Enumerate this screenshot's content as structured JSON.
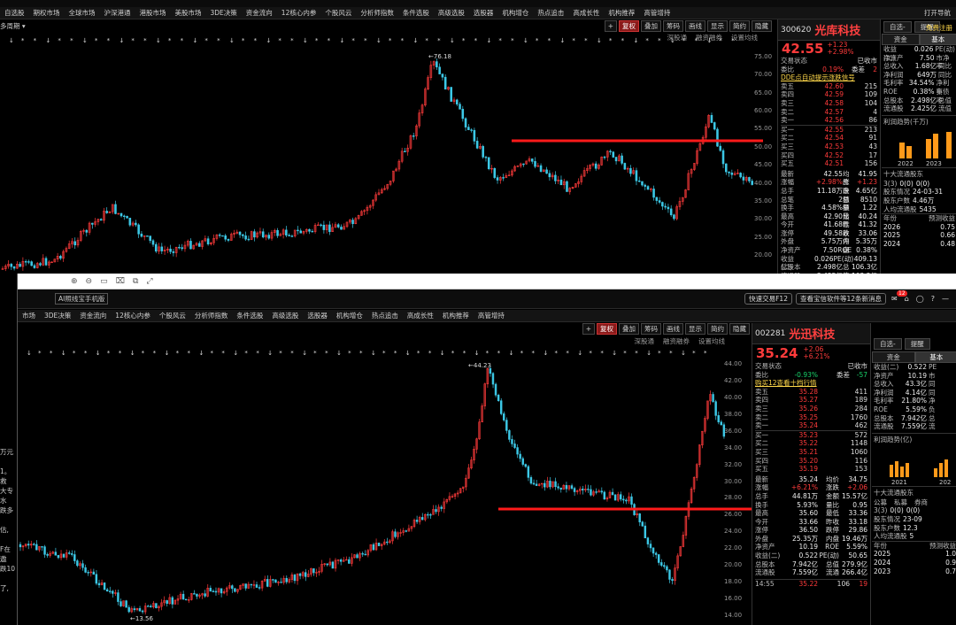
{
  "win1": {
    "menu": [
      "自选股",
      "期权市场",
      "全球市场",
      "沪深港通",
      "港股市场",
      "美股市场",
      "3DE决策",
      "资金流向",
      "12核心内参",
      "个股风云",
      "分析师指数",
      "条件选股",
      "高级选股",
      "选股器",
      "机构增仓",
      "热点追击",
      "高成长性",
      "机构推荐",
      "高管增持"
    ],
    "toolbar": [
      "复权",
      "叠加",
      "筹码",
      "画线",
      "显示",
      "简约",
      "隐藏"
    ],
    "subtabs": [
      "深股通",
      "融资融券",
      "设置均线"
    ],
    "topright": "打开导航",
    "yticks": [
      "75.00",
      "70.00",
      "65.00",
      "60.00",
      "55.00",
      "50.00",
      "45.00",
      "40.00",
      "35.00",
      "30.00",
      "25.00",
      "20.00"
    ],
    "peak_label": "76.18",
    "stock": {
      "code": "300620",
      "name": "光库科技",
      "price": "42.55",
      "change": "+1.23",
      "pct": "+2.98%",
      "status_label": "交易状态",
      "status": "已收市",
      "weibi_label": "委比",
      "weibi": "0.19%",
      "weicha_label": "委差",
      "weicha": "2",
      "link": "DDE点自动提示涨跌信号",
      "asks": [
        [
          "卖五",
          "42.60",
          "215"
        ],
        [
          "卖四",
          "42.59",
          "109"
        ],
        [
          "卖三",
          "42.58",
          "104"
        ],
        [
          "卖二",
          "42.57",
          "4"
        ],
        [
          "卖一",
          "42.56",
          "86"
        ]
      ],
      "bids": [
        [
          "买一",
          "42.55",
          "213"
        ],
        [
          "买二",
          "42.54",
          "91"
        ],
        [
          "买三",
          "42.53",
          "43"
        ],
        [
          "买四",
          "42.52",
          "17"
        ],
        [
          "买五",
          "42.51",
          "156"
        ]
      ],
      "stats": [
        [
          "最新",
          "42.55",
          "均价",
          "41.95"
        ],
        [
          "涨幅",
          "+2.98%",
          "涨跌",
          "+1.23"
        ],
        [
          "总手",
          "11.18万",
          "金额",
          "4.65亿"
        ],
        [
          "总笔",
          "2",
          "总额",
          "8510"
        ],
        [
          "换手",
          "4.58%",
          "量比",
          "1.22"
        ],
        [
          "最高",
          "42.90",
          "最低",
          "40.24"
        ],
        [
          "今开",
          "41.68",
          "昨收",
          "41.32"
        ],
        [
          "涨停",
          "49.58",
          "跌停",
          "33.06"
        ],
        [
          "外盘",
          "5.75万",
          "内盘",
          "5.35万"
        ],
        [
          "净资产",
          "7.50",
          "ROE",
          "0.38%"
        ],
        [
          "收益(二)",
          "0.026",
          "PE(动)",
          "409.13"
        ],
        [
          "总股本",
          "2.498亿",
          "总值",
          "106.3亿"
        ],
        [
          "流通股",
          "2.425亿",
          "流通",
          "103.2亿"
        ]
      ],
      "btn1": "自选-",
      "btn2": "提醒",
      "tabs": [
        "资金",
        "基本"
      ],
      "fund": [
        [
          "收益(二)",
          "0.026",
          "PE(动)"
        ],
        [
          "净资产",
          "7.50",
          "市净率"
        ],
        [
          "总收入",
          "1.68亿",
          "同比"
        ],
        [
          "净利润",
          "649万",
          "同比"
        ],
        [
          "毛利率",
          "34.54%",
          "净利率"
        ],
        [
          "ROE",
          "0.38%",
          "负债率"
        ],
        [
          "总股本",
          "2.498亿",
          "总值"
        ],
        [
          "流通股",
          "2.425亿",
          "流值"
        ]
      ],
      "profit_title": "利润趋势(千万)",
      "years": [
        "2022",
        "2023"
      ],
      "holders_title": "十大流通股东",
      "holders": [
        [
          "3(3)",
          "0(0)",
          "0(0)"
        ],
        [
          "股东情况",
          "24-03-31",
          ""
        ],
        [
          "股东户数",
          "4.46万",
          ""
        ],
        [
          "人均流通股",
          "5435",
          ""
        ]
      ],
      "forecast": [
        [
          "年份",
          "预测收益"
        ],
        [
          "2026",
          "0.75"
        ],
        [
          "2025",
          "0.66"
        ],
        [
          "2024",
          "0.48"
        ]
      ],
      "login": "免费注册"
    }
  },
  "win2": {
    "top_btns": [
      "快速交易F12",
      "查看宝信软件等12条新消息"
    ],
    "badge": "12",
    "title_left": "AI照线宝手机版",
    "menu": [
      "市场",
      "3DE决策",
      "资金流向",
      "12核心内参",
      "个股风云",
      "分析师指数",
      "条件选股",
      "高级选股",
      "选股器",
      "机构增仓",
      "热点追击",
      "高成长性",
      "机构推荐",
      "高管增持"
    ],
    "toolbar": [
      "复权",
      "叠加",
      "筹码",
      "画线",
      "显示",
      "简约",
      "隐藏"
    ],
    "subtabs": [
      "深股通",
      "融资融券",
      "设置均线"
    ],
    "yticks": [
      "44.00",
      "42.00",
      "40.00",
      "38.00",
      "36.00",
      "34.00",
      "32.00",
      "30.00",
      "28.00",
      "26.00",
      "24.00",
      "22.00",
      "20.00",
      "18.00",
      "16.00",
      "14.00"
    ],
    "peak_label": "44.23",
    "low_label": "13.56",
    "left_text": [
      "万元",
      "1。救",
      "大专水",
      "跌多",
      "估,",
      "F在遨",
      "跌10",
      "了,"
    ],
    "stock": {
      "code": "002281",
      "name": "光迅科技",
      "price": "35.24",
      "change": "+2.06",
      "pct": "+6.21%",
      "status_label": "交易状态",
      "status": "已收市",
      "weibi_label": "委比",
      "weibi": "-0.93%",
      "weicha_label": "委差",
      "weicha": "-57",
      "link": "购买12查看十档行情",
      "asks": [
        [
          "卖五",
          "35.28",
          "411"
        ],
        [
          "卖四",
          "35.27",
          "189"
        ],
        [
          "卖三",
          "35.26",
          "284"
        ],
        [
          "卖二",
          "35.25",
          "1760"
        ],
        [
          "卖一",
          "35.24",
          "462"
        ]
      ],
      "bids": [
        [
          "买一",
          "35.23",
          "572"
        ],
        [
          "买二",
          "35.22",
          "1148"
        ],
        [
          "买三",
          "35.21",
          "1060"
        ],
        [
          "买四",
          "35.20",
          "116"
        ],
        [
          "买五",
          "35.19",
          "153"
        ]
      ],
      "stats": [
        [
          "最新",
          "35.24",
          "均价",
          "34.75"
        ],
        [
          "涨幅",
          "+6.21%",
          "涨跌",
          "+2.06"
        ],
        [
          "总手",
          "44.81万",
          "金额",
          "15.57亿"
        ],
        [
          "换手",
          "5.93%",
          "量比",
          "0.95"
        ],
        [
          "最高",
          "35.60",
          "最低",
          "33.36"
        ],
        [
          "今开",
          "33.66",
          "昨收",
          "33.18"
        ],
        [
          "涨停",
          "36.50",
          "跌停",
          "29.86"
        ],
        [
          "外盘",
          "25.35万",
          "内盘",
          "19.46万"
        ],
        [
          "净资产",
          "10.19",
          "ROE",
          "5.59%"
        ],
        [
          "收益(二)",
          "0.522",
          "PE(动)",
          "50.65"
        ],
        [
          "总股本",
          "7.942亿",
          "总值",
          "279.9亿"
        ],
        [
          "流通股",
          "7.559亿",
          "流通",
          "266.4亿"
        ]
      ],
      "tick": [
        "14:55",
        "35.22",
        "106",
        "19"
      ],
      "btn1": "自选-",
      "btn2": "提醒",
      "tabs": [
        "资金",
        "基本"
      ],
      "fund": [
        [
          "收益(二)",
          "0.522",
          "PE"
        ],
        [
          "净资产",
          "10.19",
          "市"
        ],
        [
          "总收入",
          "43.3亿",
          "同"
        ],
        [
          "净利润",
          "4.14亿",
          "同"
        ],
        [
          "毛利率",
          "21.80%",
          "净"
        ],
        [
          "ROE",
          "5.59%",
          "负"
        ],
        [
          "总股本",
          "7.942亿",
          "总"
        ],
        [
          "流通股",
          "7.559亿",
          "流"
        ]
      ],
      "profit_title": "利润趋势(亿)",
      "years": [
        "2021",
        "202"
      ],
      "holders_title": "十大流通股东",
      "holders_hdr": [
        "公募",
        "私募",
        "券商"
      ],
      "holders": [
        [
          "3(3)",
          "0(0)",
          "0(0)"
        ],
        [
          "股东情况",
          "23-09",
          ""
        ],
        [
          "股东户数",
          "12.3",
          ""
        ],
        [
          "人均流通股",
          "5",
          ""
        ]
      ],
      "forecast": [
        [
          "年份",
          "预测收益"
        ],
        [
          "2025",
          "1.0"
        ],
        [
          "2024",
          "0.9"
        ],
        [
          "2023",
          "0.7"
        ]
      ]
    }
  },
  "colors": {
    "up": "#ff3b3b",
    "down": "#19d46b",
    "line": "#ff1a1a",
    "cyan": "#3cc8e6"
  }
}
